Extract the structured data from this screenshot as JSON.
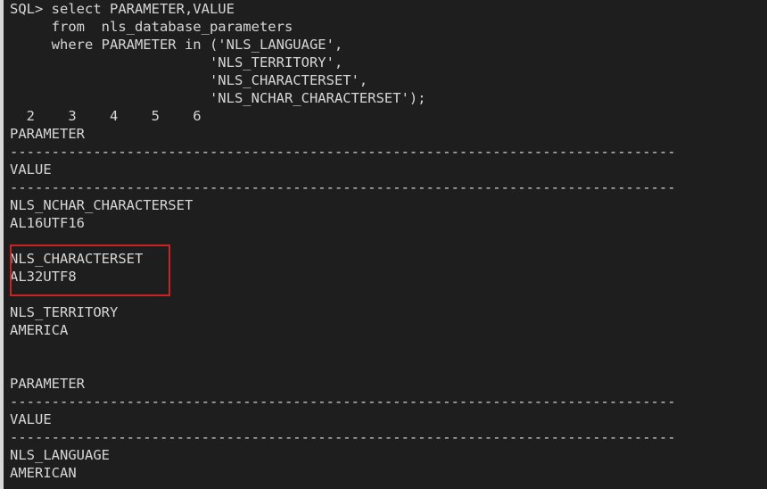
{
  "terminal": {
    "background_color": "#1e1e1e",
    "text_color": "#d6d6d6",
    "gutter_color": "#d8d8d8",
    "prompt": "SQL>",
    "query_lines": [
      "SQL> select PARAMETER,VALUE",
      "     from  nls_database_parameters",
      "     where PARAMETER in ('NLS_LANGUAGE',",
      "                        'NLS_TERRITORY',",
      "                        'NLS_CHARACTERSET',",
      "                        'NLS_NCHAR_CHARACTERSET');"
    ],
    "continuation_numbers": "  2    3    4    5    6",
    "result_block_1": {
      "header_parameter": "PARAMETER",
      "separator_1": "--------------------------------------------------------------------------------",
      "header_value": "VALUE",
      "separator_2": "--------------------------------------------------------------------------------",
      "rows": [
        {
          "parameter": "NLS_NCHAR_CHARACTERSET",
          "value": "AL16UTF16"
        },
        {
          "parameter": "NLS_CHARACTERSET",
          "value": "AL32UTF8"
        },
        {
          "parameter": "NLS_TERRITORY",
          "value": "AMERICA"
        }
      ]
    },
    "result_block_2": {
      "header_parameter": "PARAMETER",
      "separator_1": "--------------------------------------------------------------------------------",
      "header_value": "VALUE",
      "separator_2": "--------------------------------------------------------------------------------",
      "rows": [
        {
          "parameter": "NLS_LANGUAGE",
          "value": "AMERICAN"
        }
      ]
    }
  },
  "annotation": {
    "name": "nls-characterset-highlight",
    "color": "#cc2222",
    "targets": [
      "NLS_CHARACTERSET",
      "AL32UTF8"
    ]
  }
}
